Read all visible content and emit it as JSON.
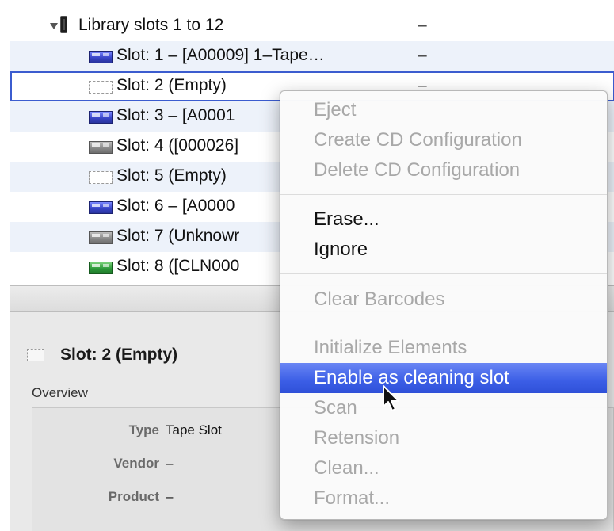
{
  "tree": {
    "library_row": {
      "label": "Library slots 1 to 12",
      "value": "–"
    },
    "slots": [
      {
        "label": "Slot: 1 – [A00009] 1–Tape…",
        "value": "–",
        "icon": "blue-tape-icon"
      },
      {
        "label": "Slot: 2 (Empty)",
        "value": "–",
        "icon": "empty-slot-icon"
      },
      {
        "label": "Slot: 3 – [A0001",
        "value": "",
        "icon": "blue-tape-icon"
      },
      {
        "label": "Slot: 4 ([000026]",
        "value": "",
        "icon": "gray-tape-icon"
      },
      {
        "label": "Slot: 5 (Empty)",
        "value": "",
        "icon": "empty-slot-icon"
      },
      {
        "label": "Slot: 6 – [A0000",
        "value": "",
        "icon": "blue-tape-icon"
      },
      {
        "label": "Slot: 7 (Unknowr",
        "value": "",
        "icon": "gray-tape-icon"
      },
      {
        "label": "Slot: 8 ([CLN000",
        "value": "",
        "icon": "green-tape-icon"
      }
    ]
  },
  "detail": {
    "title": "Slot: 2 (Empty)",
    "overview_label": "Overview",
    "properties": [
      {
        "label": "Type",
        "value": "Tape Slot"
      },
      {
        "label": "Vendor",
        "value": "–"
      },
      {
        "label": "Product",
        "value": "–"
      }
    ]
  },
  "context_menu": {
    "groups": [
      [
        {
          "label": "Eject",
          "enabled": false
        },
        {
          "label": "Create CD Configuration",
          "enabled": false
        },
        {
          "label": "Delete CD Configuration",
          "enabled": false
        }
      ],
      [
        {
          "label": "Erase...",
          "enabled": true
        },
        {
          "label": "Ignore",
          "enabled": true
        }
      ],
      [
        {
          "label": "Clear Barcodes",
          "enabled": false
        }
      ],
      [
        {
          "label": "Initialize Elements",
          "enabled": false
        },
        {
          "label": "Enable as cleaning slot",
          "enabled": true,
          "highlighted": true
        },
        {
          "label": "Scan",
          "enabled": false
        },
        {
          "label": "Retension",
          "enabled": false
        },
        {
          "label": "Clean...",
          "enabled": false
        },
        {
          "label": "Format...",
          "enabled": false
        }
      ]
    ]
  },
  "colors": {
    "selection_border": "#3b5ccf",
    "menu_highlight": "#3b5ee6",
    "row_alt": "#edf2fa",
    "disabled_text": "#a8a8a8"
  }
}
